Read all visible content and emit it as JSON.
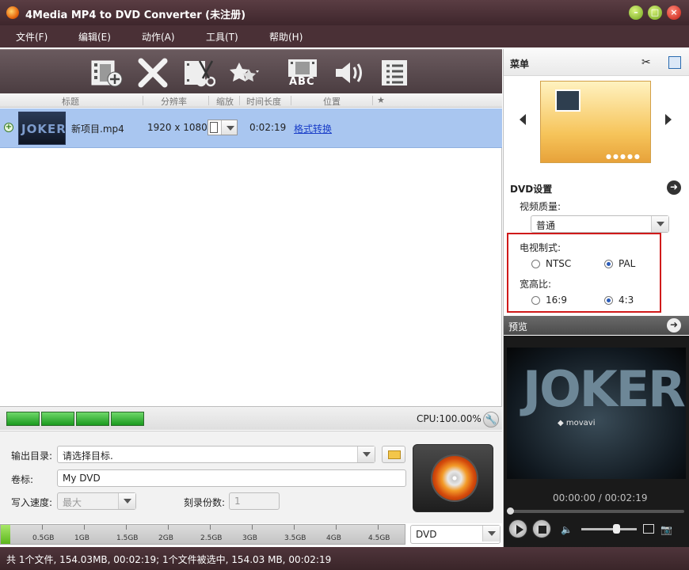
{
  "window": {
    "title": "4Media MP4 to DVD Converter (未注册)"
  },
  "menu": [
    "文件(F)",
    "编辑(E)",
    "动作(A)",
    "工具(T)",
    "帮助(H)"
  ],
  "toolbar": {
    "tools": [
      {
        "icon": "add-file-icon"
      },
      {
        "icon": "delete-icon"
      },
      {
        "icon": "clip-icon"
      },
      {
        "icon": "effects-icon"
      },
      {
        "icon": "subtitle-icon",
        "label": "ABC"
      },
      {
        "icon": "audio-icon"
      },
      {
        "icon": "chapters-icon"
      }
    ]
  },
  "list": {
    "columns": [
      "标题",
      "分辨率",
      "缩放",
      "时间长度",
      "位置",
      "★"
    ],
    "rows": [
      {
        "thumb_text": "JOKER",
        "title": "新项目.mp4",
        "resolution": "1920 x 1080",
        "duration": "0:02:19",
        "location": "格式转换"
      }
    ]
  },
  "cpu": {
    "label": "CPU:100.00%"
  },
  "output": {
    "dir_label": "输出目录:",
    "dir_placeholder": "请选择目标.",
    "volume_label": "卷标:",
    "volume_value": "My DVD",
    "speed_label": "写入速度:",
    "speed_value": "最大",
    "copies_label": "刻录份数:",
    "copies_value": "1"
  },
  "capacity": {
    "fill_fraction": 0.02,
    "ticks": [
      "0.5GB",
      "1GB",
      "1.5GB",
      "2GB",
      "2.5GB",
      "3GB",
      "3.5GB",
      "4GB",
      "4.5GB"
    ],
    "disc_type": "DVD"
  },
  "status": {
    "text": "共 1个文件, 154.03MB,  00:02:19; 1个文件被选中, 154.03 MB,  00:02:19"
  },
  "right": {
    "menu_title": "菜单",
    "dvd_title": "DVD设置",
    "quality_label": "视频质量:",
    "quality_value": "普通",
    "tv_label": "电视制式:",
    "tv_options": [
      "NTSC",
      "PAL"
    ],
    "tv_selected": "PAL",
    "aspect_label": "宽高比:",
    "aspect_options": [
      "16:9",
      "4:3"
    ],
    "aspect_selected": "4:3",
    "preview_title": "预览",
    "preview_text": "JOKER",
    "preview_watermark": "◆ movavi",
    "time": "00:00:00 / 00:02:19"
  },
  "colors": {
    "accent_red": "#d01a1a",
    "selection": "#a9c6f0",
    "titlebar": "#4a3036"
  }
}
